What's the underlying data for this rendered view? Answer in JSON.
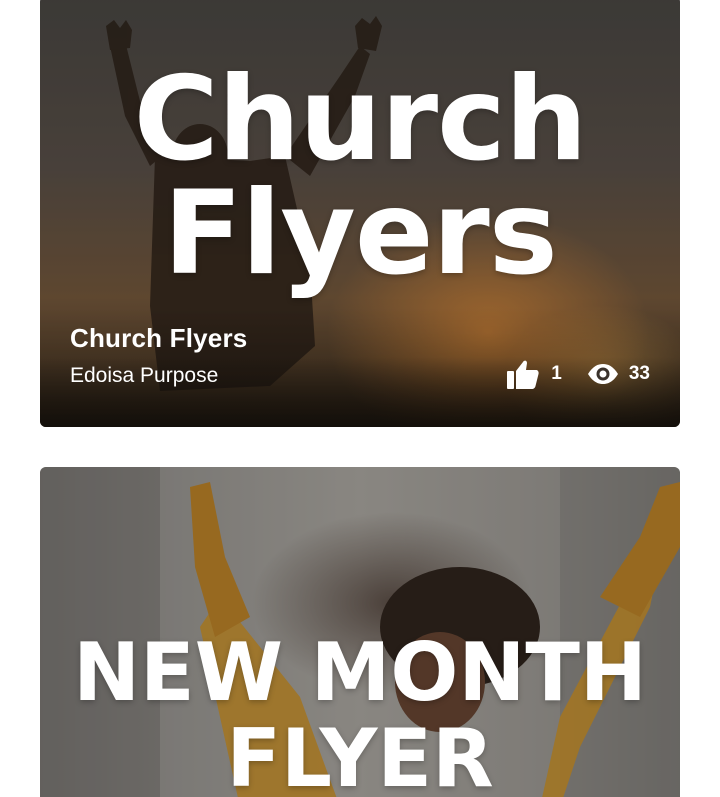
{
  "cards": [
    {
      "headline_line1": "Church",
      "headline_line2": "Flyers",
      "title": "Church Flyers",
      "author": "Edoisa Purpose",
      "likes": "1",
      "views": "33",
      "like_icon": "thumbs-up-icon",
      "view_icon": "eye-icon"
    },
    {
      "headline_line1": "NEW MONTH",
      "headline_line2": "FLYER"
    }
  ]
}
